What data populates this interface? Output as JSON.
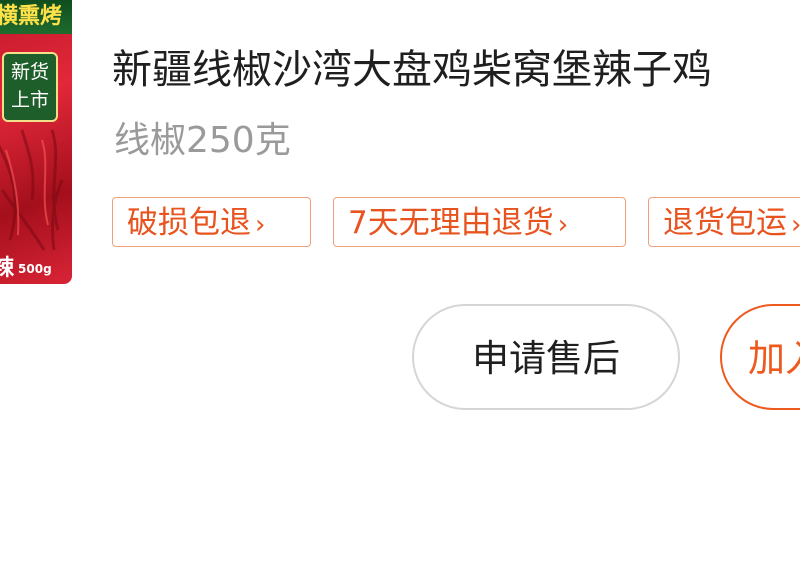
{
  "product": {
    "image": {
      "top_text": "横熏烤",
      "badge_line1": "新货",
      "badge_line2": "上市",
      "bottom_text": "辣",
      "net_weight": "500g"
    },
    "title": "新疆线椒沙湾大盘鸡柴窝堡辣子鸡",
    "spec": "线椒250克"
  },
  "service_tags": [
    {
      "label": "破损包退",
      "chevron": "›"
    },
    {
      "label": "7天无理由退货",
      "chevron": "›"
    },
    {
      "label": "退货包运",
      "chevron": "›"
    }
  ],
  "actions": {
    "after_sales_label": "申请售后",
    "add_cart_label": "加入"
  },
  "colors": {
    "accent": "#ee5a1e",
    "tag_border": "#f0a07c",
    "spec_text": "#9a9a9a",
    "title_text": "#1f1f1f"
  }
}
